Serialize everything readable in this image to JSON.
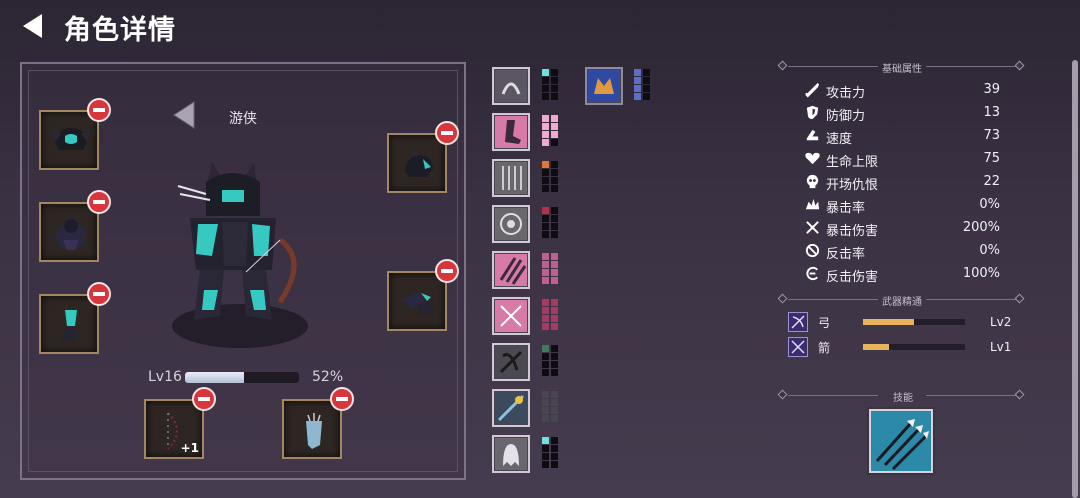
{
  "header": {
    "title": "角色详情"
  },
  "hero": {
    "class_name": "游侠",
    "level_label": "Lv16",
    "xp_percent_label": "52%",
    "xp_fraction": 0.52
  },
  "equipment": {
    "bow_bonus": "+1"
  },
  "stats_section": {
    "title": "基础属性",
    "stats": [
      {
        "icon": "sword-icon",
        "name": "攻击力",
        "value": "39"
      },
      {
        "icon": "shield-icon",
        "name": "防御力",
        "value": "13"
      },
      {
        "icon": "speed-boot-icon",
        "name": "速度",
        "value": "73"
      },
      {
        "icon": "heart-icon",
        "name": "生命上限",
        "value": "75"
      },
      {
        "icon": "skull-icon",
        "name": "开场仇恨",
        "value": "22"
      },
      {
        "icon": "crit-burst-icon",
        "name": "暴击率",
        "value": "0%"
      },
      {
        "icon": "crit-damage-icon",
        "name": "暴击伤害",
        "value": "200%"
      },
      {
        "icon": "counter-icon",
        "name": "反击率",
        "value": "0%"
      },
      {
        "icon": "counter-damage-icon",
        "name": "反击伤害",
        "value": "100%"
      }
    ]
  },
  "mastery_section": {
    "title": "武器精通",
    "items": [
      {
        "icon": "bow-mastery-icon",
        "name": "弓",
        "level": "Lv2",
        "progress": 0.5
      },
      {
        "icon": "arrow-mastery-icon",
        "name": "箭",
        "level": "Lv1",
        "progress": 0.25
      }
    ]
  },
  "skills_section": {
    "title": "技能",
    "icon": "arrow-volley-skill-icon"
  },
  "colors": {
    "remove": "#d8363d",
    "slot_border": "#a18862",
    "mastery_fill": "#e8b45a",
    "teal": "#35c9c1"
  }
}
